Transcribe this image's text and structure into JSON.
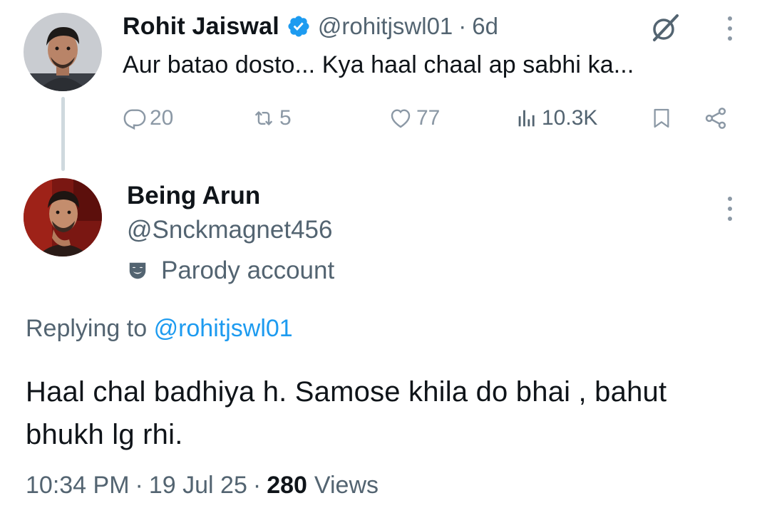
{
  "parent_tweet": {
    "name": "Rohit Jaiswal",
    "handle": "@rohitjswl01",
    "separator": "·",
    "time": "6d",
    "text": "Aur batao dosto... Kya haal chaal ap sabhi ka...",
    "stats": {
      "replies": "20",
      "reposts": "5",
      "likes": "77",
      "views": "10.3K"
    },
    "icons": {
      "verified": "verified-badge-icon",
      "grok": "grok-icon",
      "more": "more-vertical-icon",
      "reply": "reply-icon",
      "repost": "repost-icon",
      "like": "heart-icon",
      "views": "views-chart-icon",
      "bookmark": "bookmark-icon",
      "share": "share-icon"
    }
  },
  "reply_tweet": {
    "name": "Being Arun",
    "handle": "@Snckmagnet456",
    "parody_label": "Parody account",
    "replying_prefix": "Replying to",
    "replying_mention": "@rohitjswl01",
    "text": "Haal chal badhiya h. Samose khila do bhai , bahut bhukh lg rhi.",
    "time": "10:34 PM",
    "date": "19 Jul 25",
    "separator": "·",
    "views_count": "280",
    "views_label": "Views",
    "icons": {
      "parody": "theater-mask-icon",
      "more": "more-vertical-icon"
    }
  },
  "colors": {
    "text_primary": "#0f1419",
    "text_secondary": "#536471",
    "action_gray": "#8b98a5",
    "accent_blue": "#1d9bf0",
    "thread_line": "#cfd9de"
  }
}
